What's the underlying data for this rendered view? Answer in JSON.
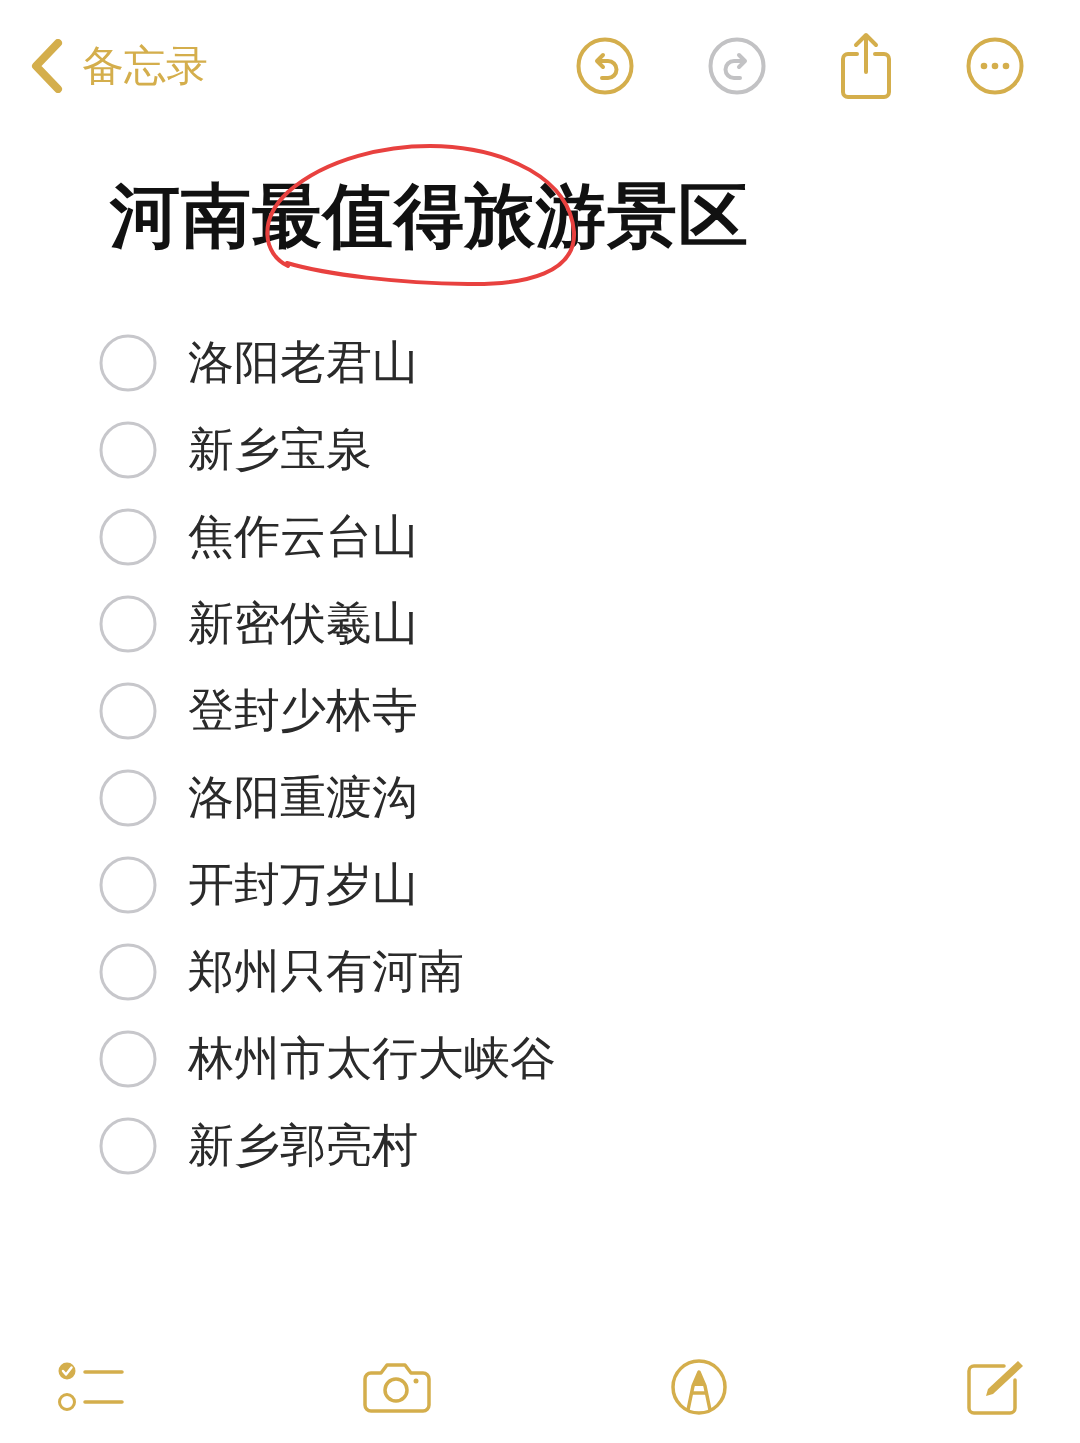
{
  "nav": {
    "back_label": "备忘录",
    "actions": [
      {
        "kind": "undo",
        "disabled": false
      },
      {
        "kind": "redo",
        "disabled": true
      },
      {
        "kind": "share",
        "disabled": false
      },
      {
        "kind": "more",
        "disabled": false
      }
    ]
  },
  "note": {
    "title": "河南最值得旅游景区",
    "title_circled": true,
    "checklist": [
      {
        "text": "洛阳老君山",
        "checked": false
      },
      {
        "text": "新乡宝泉",
        "checked": false
      },
      {
        "text": "焦作云台山",
        "checked": false
      },
      {
        "text": "新密伏羲山",
        "checked": false
      },
      {
        "text": "登封少林寺",
        "checked": false
      },
      {
        "text": "洛阳重渡沟",
        "checked": false
      },
      {
        "text": "开封万岁山",
        "checked": false
      },
      {
        "text": "郑州只有河南",
        "checked": false
      },
      {
        "text": "林州市太行大峡谷",
        "checked": false
      },
      {
        "text": "新乡郭亮村",
        "checked": false
      }
    ]
  },
  "toolbar": [
    {
      "kind": "checklist"
    },
    {
      "kind": "camera"
    },
    {
      "kind": "markup"
    },
    {
      "kind": "compose"
    }
  ]
}
